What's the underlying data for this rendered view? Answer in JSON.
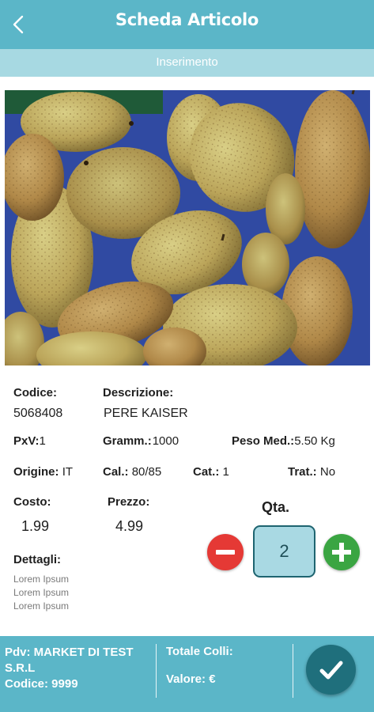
{
  "header": {
    "title": "Scheda Articolo",
    "back_icon": "chevron-left-icon"
  },
  "subheader": {
    "label": "Inserimento"
  },
  "product": {
    "image_alt_icon": "pears-photo",
    "codice_label": "Codice:",
    "codice_value": "5068408",
    "descrizione_label": "Descrizione:",
    "descrizione_value": "PERE KAISER",
    "pxv_label": "PxV:",
    "pxv_value": "1",
    "gramm_label": "Gramm.:",
    "gramm_value": "1000",
    "peso_label": "Peso Med.:",
    "peso_value": "5.50 Kg",
    "origine_label": "Origine:",
    "origine_value": "IT",
    "cal_label": "Cal.:",
    "cal_value": "80/85",
    "cat_label": "Cat.:",
    "cat_value": "1",
    "trat_label": "Trat.:",
    "trat_value": "No",
    "costo_label": "Costo:",
    "costo_value": "1.99",
    "prezzo_label": "Prezzo:",
    "prezzo_value": "4.99",
    "dettagli_label": "Dettagli:",
    "dettagli_lines": [
      "Lorem Ipsum",
      "Lorem Ipsum",
      "Lorem Ipsum"
    ]
  },
  "quantity": {
    "label": "Qta.",
    "value": "2",
    "minus_icon": "minus-icon",
    "plus_icon": "plus-icon"
  },
  "footer": {
    "pdv_line1": "Pdv: MARKET DI TEST",
    "pdv_line2": "S.R.L",
    "pdv_line3": "Codice: 9999",
    "totale_colli": "Totale Colli:",
    "valore": "Valore: €",
    "confirm_icon": "checkmark-icon"
  },
  "colors": {
    "header": "#5bb6c8",
    "subheader": "#a7d9e2",
    "minus": "#e53935",
    "plus": "#3aa542",
    "qty_box": "#a9d9e3",
    "confirm": "#1f6f7c"
  }
}
